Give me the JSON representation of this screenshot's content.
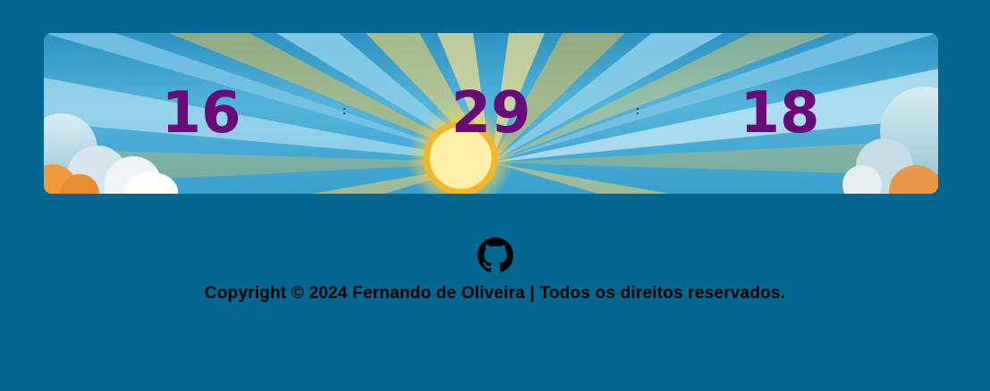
{
  "clock": {
    "hours": "16",
    "separator_1": ":",
    "minutes": "29",
    "separator_2": ":",
    "seconds": "18",
    "digit_color": "#6a0a78"
  },
  "banner": {
    "image": "sun-rays-sky-illustration"
  },
  "footer": {
    "github_icon": "github-icon",
    "copyright": "Copyright © 2024 Fernando de Oliveira | Todos os direitos reservados."
  },
  "colors": {
    "page_background": "#03668f",
    "text": "#000000"
  }
}
